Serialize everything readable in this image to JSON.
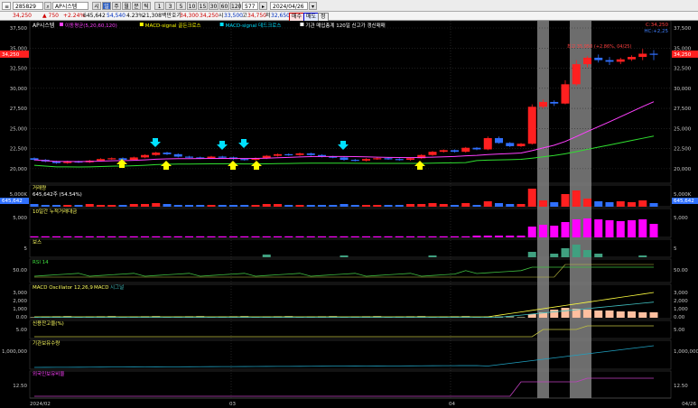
{
  "toolbar": {
    "code": "285829",
    "name": "AP시스템",
    "period_buttons": [
      "시",
      "일",
      "주",
      "월",
      "분",
      "틱"
    ],
    "minute_buttons": [
      "1",
      "3",
      "5",
      "10",
      "15",
      "30",
      "60",
      "120"
    ],
    "count": "577",
    "date": "2024/04/26"
  },
  "quote": {
    "price": "34,250",
    "change": "▲ 750",
    "rate": "+2.24%",
    "volume": "645,642",
    "prev_volume": "54,540",
    "turnover_rate": "4.23%",
    "amount": "21,308백만",
    "open_label": "호가",
    "open_value": "34,300",
    "ask_value": "34,250",
    "low_label": "시",
    "low_value": "33,500",
    "high_label": "고",
    "high_value": "34,750",
    "close_label": "저",
    "close_value": "32,650",
    "buy_btn": "매수",
    "sell_btn": "매도",
    "extra_btn": "정"
  },
  "price_panel": {
    "title": "AP시스템",
    "legend": [
      {
        "text": "이동평균(5,20,60,120)",
        "color": "#ff40ff"
      },
      {
        "text": "MACD-signal 골든크로스",
        "color": "#ffff00"
      },
      {
        "text": "MACD-signal 데드크로스",
        "color": "#00e0ff"
      },
      {
        "text": "기관 매입총계 120일 신고가 갱신매매",
        "color": "#ffffff"
      }
    ],
    "yticks": [
      "37,500",
      "35,000",
      "32,500",
      "30,000",
      "27,500",
      "25,000",
      "22,500",
      "20,000"
    ],
    "last_price_label": "34,250",
    "high_marker": "최고 35,950 (+2.86%, 04/25)",
    "right_legend": [
      "C:34,250",
      "HC:+2,25"
    ]
  },
  "volume_panel": {
    "title": "거래량",
    "value_text": "645,642주 (54.54%)",
    "ytick": "5,000K",
    "last_label": "645,642"
  },
  "cum_panel": {
    "title": "10일간 누적거래대금",
    "ytick": "5,000"
  },
  "bs_panel": {
    "title": "보스",
    "ytick": "5"
  },
  "rsi_panel": {
    "title": "RSI 14",
    "ytick": "50.00"
  },
  "macd_panel": {
    "title": "MACD Oscillator 12,26,9",
    "title2": "MACD",
    "title3": "시그널",
    "yticks": [
      "3,000",
      "2,000",
      "1,000",
      "0.00"
    ]
  },
  "credit_panel": {
    "title": "신용잔고율(%)",
    "ytick": "5.00"
  },
  "inst_panel": {
    "title": "기관보유수량",
    "ytick": "1,000,000"
  },
  "foreign_panel": {
    "title": "외국인보유비율",
    "ytick": "12.50"
  },
  "xaxis": {
    "labels": [
      "2024/02",
      "03",
      "04"
    ],
    "right_date": "04/26"
  },
  "colors": {
    "up": "#ff2020",
    "down": "#3070ff",
    "ma5": "#ff40ff",
    "ma20": "#30e030",
    "highlight": "#808080"
  }
}
